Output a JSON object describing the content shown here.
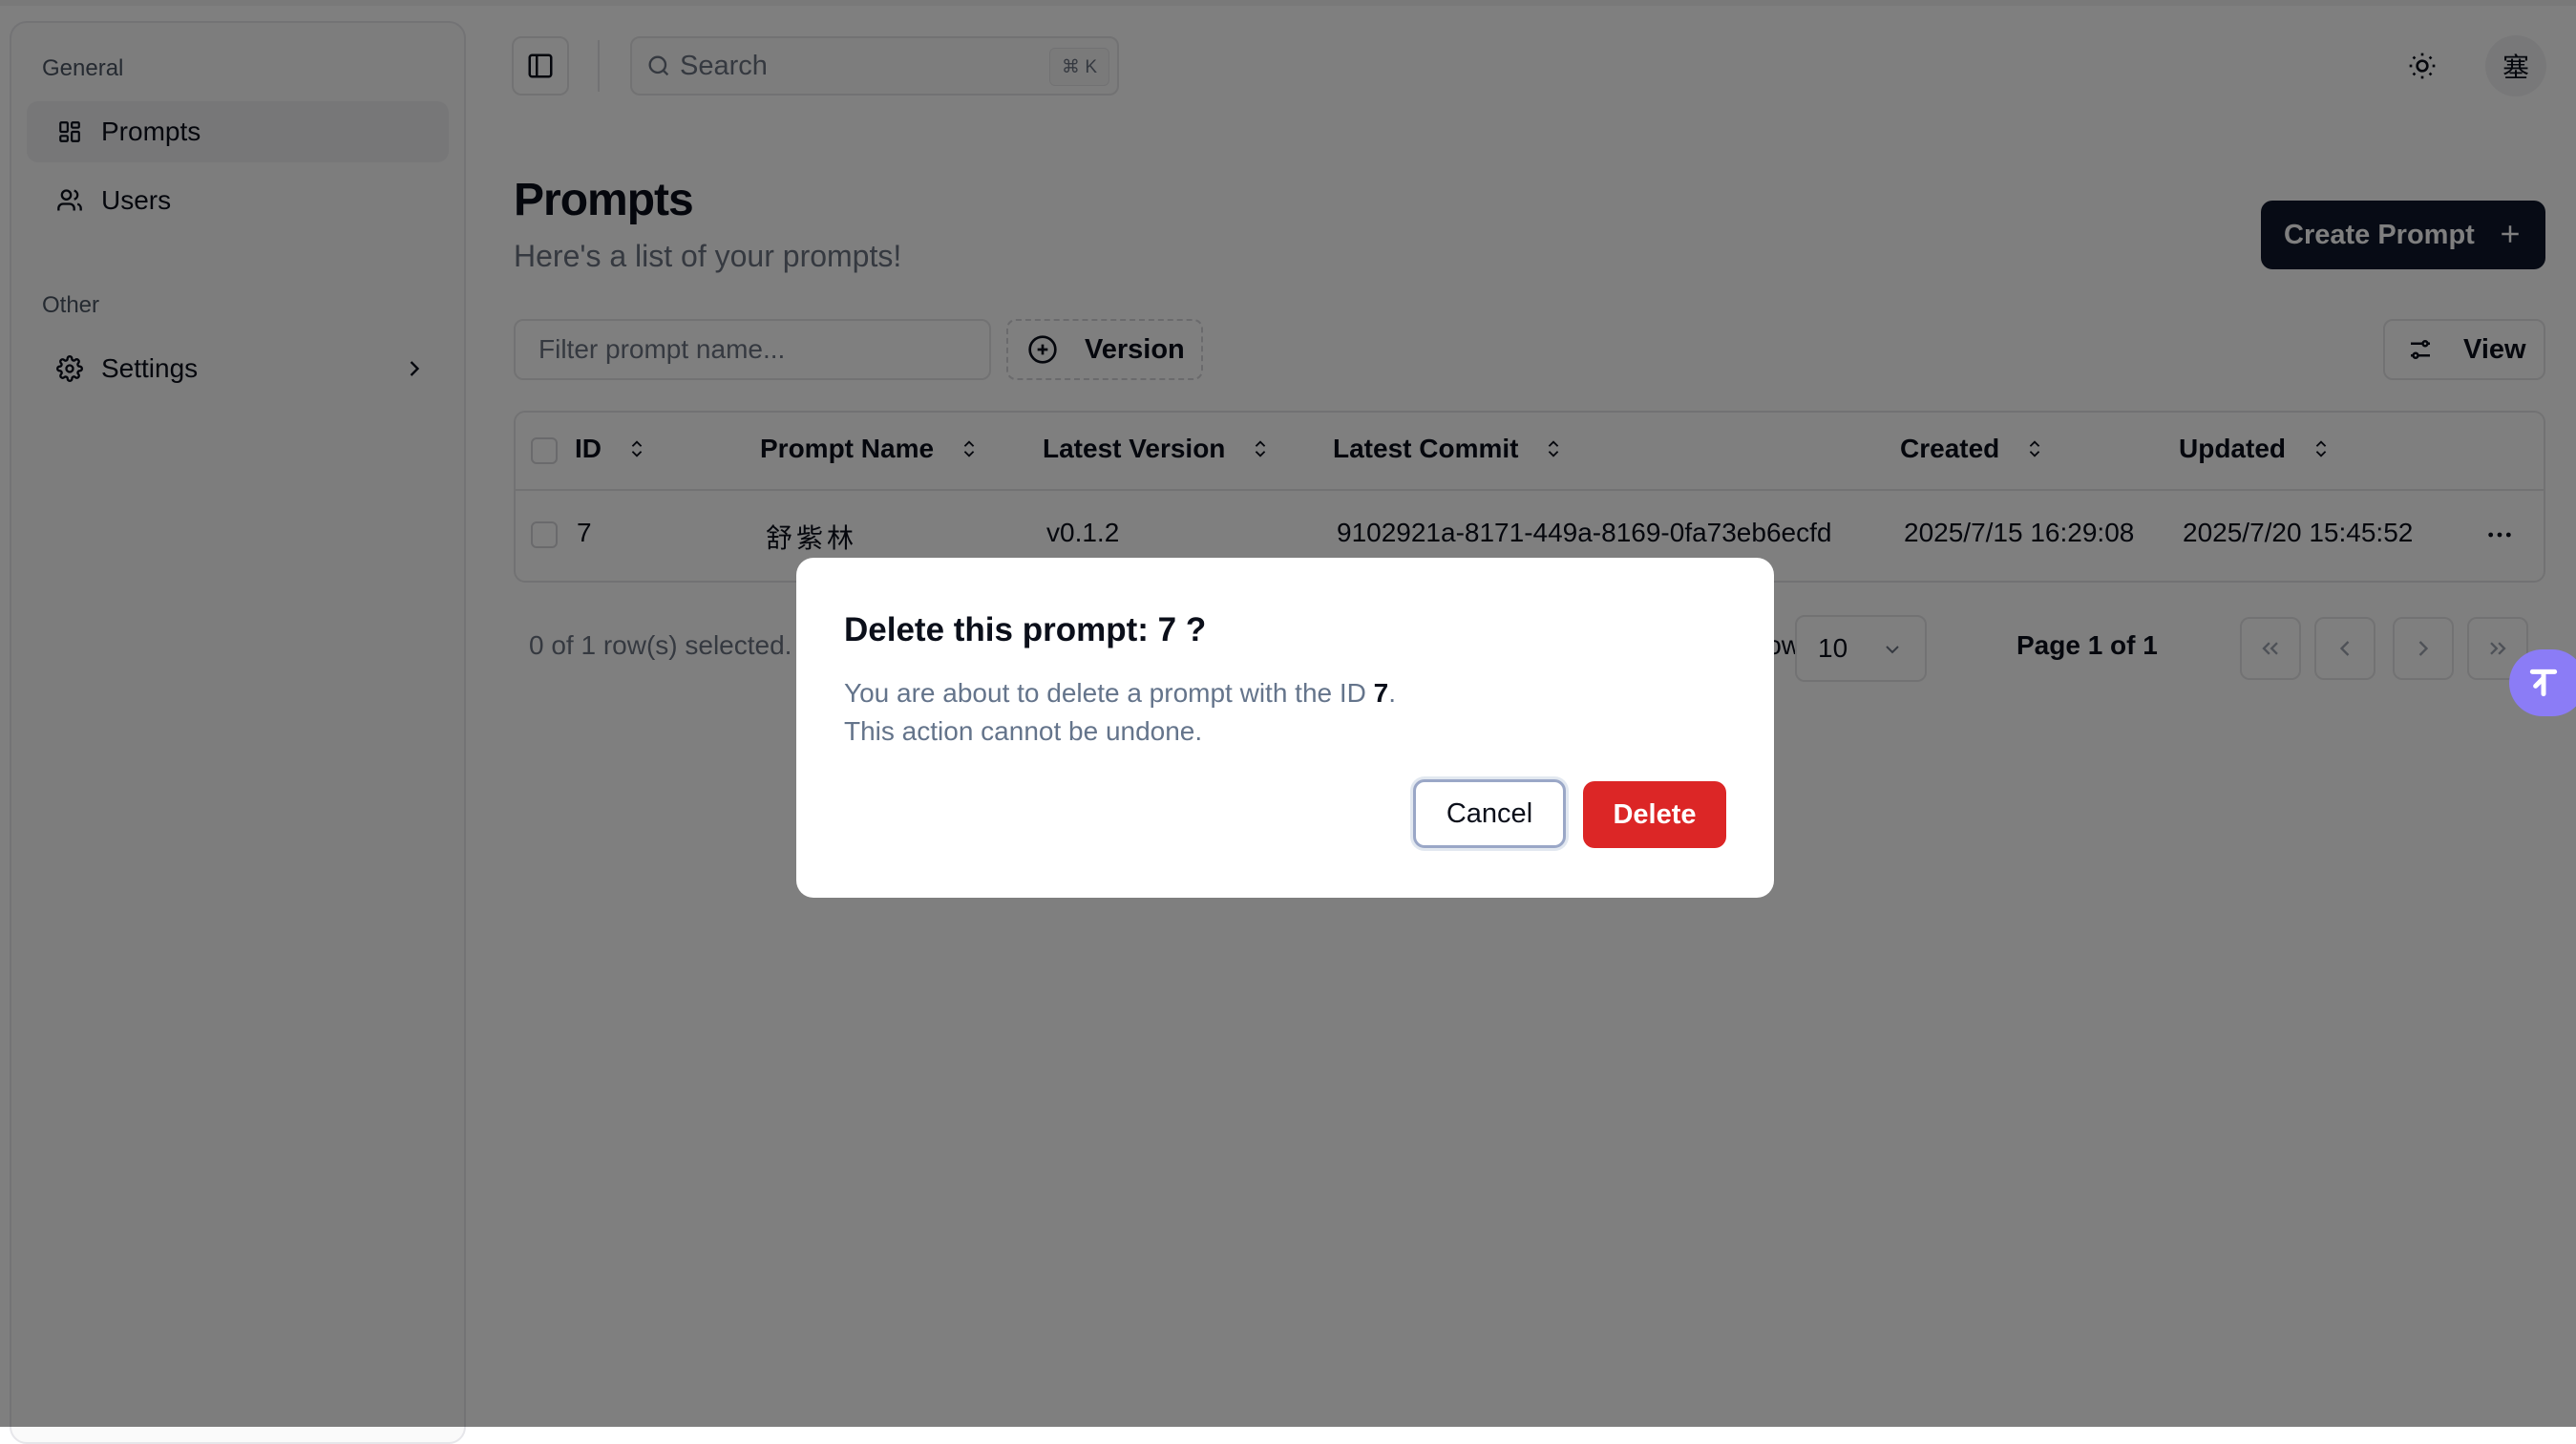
{
  "sidebar": {
    "groups": [
      {
        "label": "General"
      },
      {
        "label": "Other"
      }
    ],
    "items": [
      {
        "label": "Prompts",
        "icon": "dashboard-icon"
      },
      {
        "label": "Users",
        "icon": "users-icon"
      },
      {
        "label": "Settings",
        "icon": "gear-icon"
      }
    ]
  },
  "header": {
    "search_placeholder": "Search",
    "search_shortcut": "⌘ K",
    "avatar_text": "塞"
  },
  "main": {
    "title": "Prompts",
    "subtitle": "Here's a list of your prompts!",
    "create_label": "Create Prompt",
    "filter_placeholder": "Filter prompt name...",
    "version_label": "Version",
    "view_label": "View"
  },
  "table": {
    "columns": [
      "ID",
      "Prompt Name",
      "Latest Version",
      "Latest Commit",
      "Created",
      "Updated"
    ],
    "rows": [
      {
        "id": "7",
        "name": "舒紫林",
        "version": "v0.1.2",
        "commit": "9102921a-8171-449a-8169-0fa73eb6ecfd",
        "created": "2025/7/15 16:29:08",
        "updated": "2025/7/20 15:45:52"
      }
    ]
  },
  "pagination": {
    "selected_text": "0 of 1 row(s) selected.",
    "rows_per_page_label": "Rows per page",
    "rows_per_page": "10",
    "page_info": "Page 1 of 1"
  },
  "dialog": {
    "title": "Delete this prompt: 7 ?",
    "desc_prefix": "You are about to delete a prompt with the ID ",
    "desc_id": "7",
    "desc_suffix": ".",
    "desc_line2": "This action cannot be undone.",
    "cancel_label": "Cancel",
    "delete_label": "Delete"
  },
  "colors": {
    "primary": "#0f172a",
    "danger": "#dc2626",
    "muted": "#64748b",
    "fab": "#8b7cf6"
  }
}
